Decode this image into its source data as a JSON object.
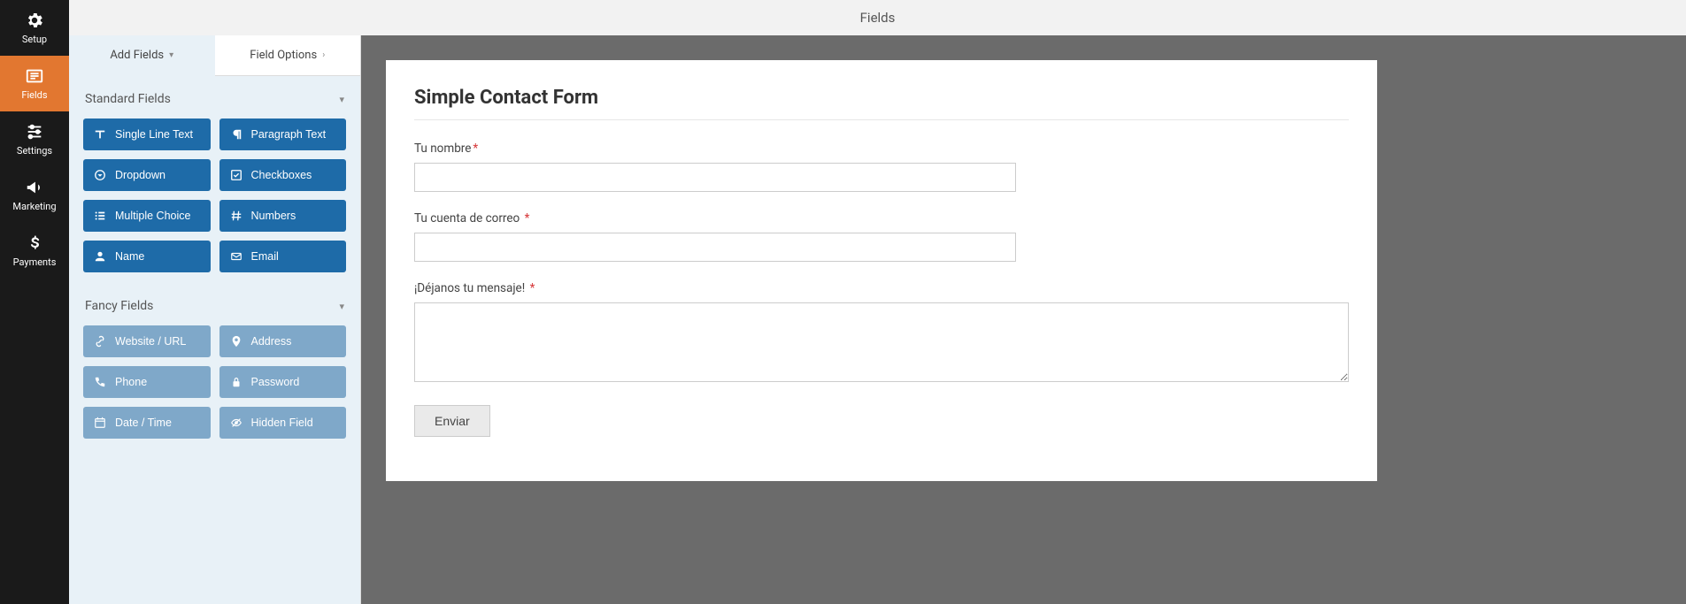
{
  "sidenav": {
    "items": [
      {
        "id": "setup",
        "label": "Setup"
      },
      {
        "id": "fields",
        "label": "Fields"
      },
      {
        "id": "settings",
        "label": "Settings"
      },
      {
        "id": "marketing",
        "label": "Marketing"
      },
      {
        "id": "payments",
        "label": "Payments"
      }
    ]
  },
  "header": {
    "title": "Fields"
  },
  "tabs": {
    "add_fields": "Add Fields",
    "field_options": "Field Options"
  },
  "sections": {
    "standard_title": "Standard Fields",
    "fancy_title": "Fancy Fields"
  },
  "standard_fields": {
    "single_line": "Single Line Text",
    "paragraph": "Paragraph Text",
    "dropdown": "Dropdown",
    "checkboxes": "Checkboxes",
    "multiple_choice": "Multiple Choice",
    "numbers": "Numbers",
    "name": "Name",
    "email": "Email"
  },
  "fancy_fields": {
    "website": "Website / URL",
    "address": "Address",
    "phone": "Phone",
    "password": "Password",
    "datetime": "Date / Time",
    "hidden": "Hidden Field"
  },
  "form": {
    "title": "Simple Contact Form",
    "name_label": "Tu nombre",
    "email_label": "Tu cuenta de correo",
    "message_label": "¡Déjanos tu mensaje!",
    "submit": "Enviar"
  }
}
